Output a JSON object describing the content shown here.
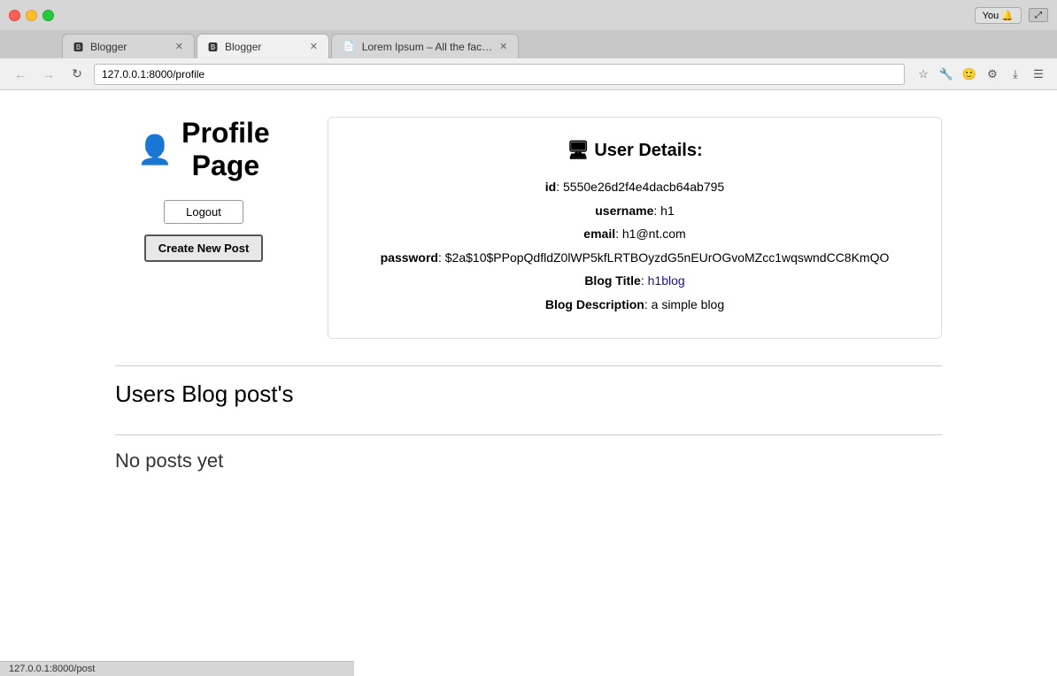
{
  "browser": {
    "tabs": [
      {
        "id": "tab1",
        "label": "Blogger",
        "active": false,
        "favicon": "B"
      },
      {
        "id": "tab2",
        "label": "Blogger",
        "active": true,
        "favicon": "B"
      },
      {
        "id": "tab3",
        "label": "Lorem Ipsum – All the fac…",
        "active": false,
        "favicon": "L"
      }
    ],
    "url": "127.0.0.1:8000/profile",
    "user_badge": "You 🔔",
    "status_bar_text": "127.0.0.1:8000/post"
  },
  "profile": {
    "icon": "👤",
    "title_line1": "Profile",
    "title_line2": "Page",
    "logout_label": "Logout",
    "create_post_label": "Create New Post"
  },
  "user_details": {
    "section_title": "🖥 User Details:",
    "id_label": "id",
    "id_value": "5550e26d2f4e4dacb64ab795",
    "username_label": "username",
    "username_value": "h1",
    "email_label": "email",
    "email_value": "h1@nt.com",
    "password_label": "password",
    "password_value": "$2a$10$PPopQdfldZ0lWP5kfLRTBOyzdG5nEUrOGvoMZcc1wqswndCC8KmQO",
    "blog_title_label": "Blog Title",
    "blog_title_value": "h1blog",
    "blog_title_href": "#",
    "blog_desc_label": "Blog Description",
    "blog_desc_value": "a simple blog"
  },
  "blog_posts": {
    "section_heading": "Users Blog post's",
    "no_posts_text": "No posts yet"
  }
}
